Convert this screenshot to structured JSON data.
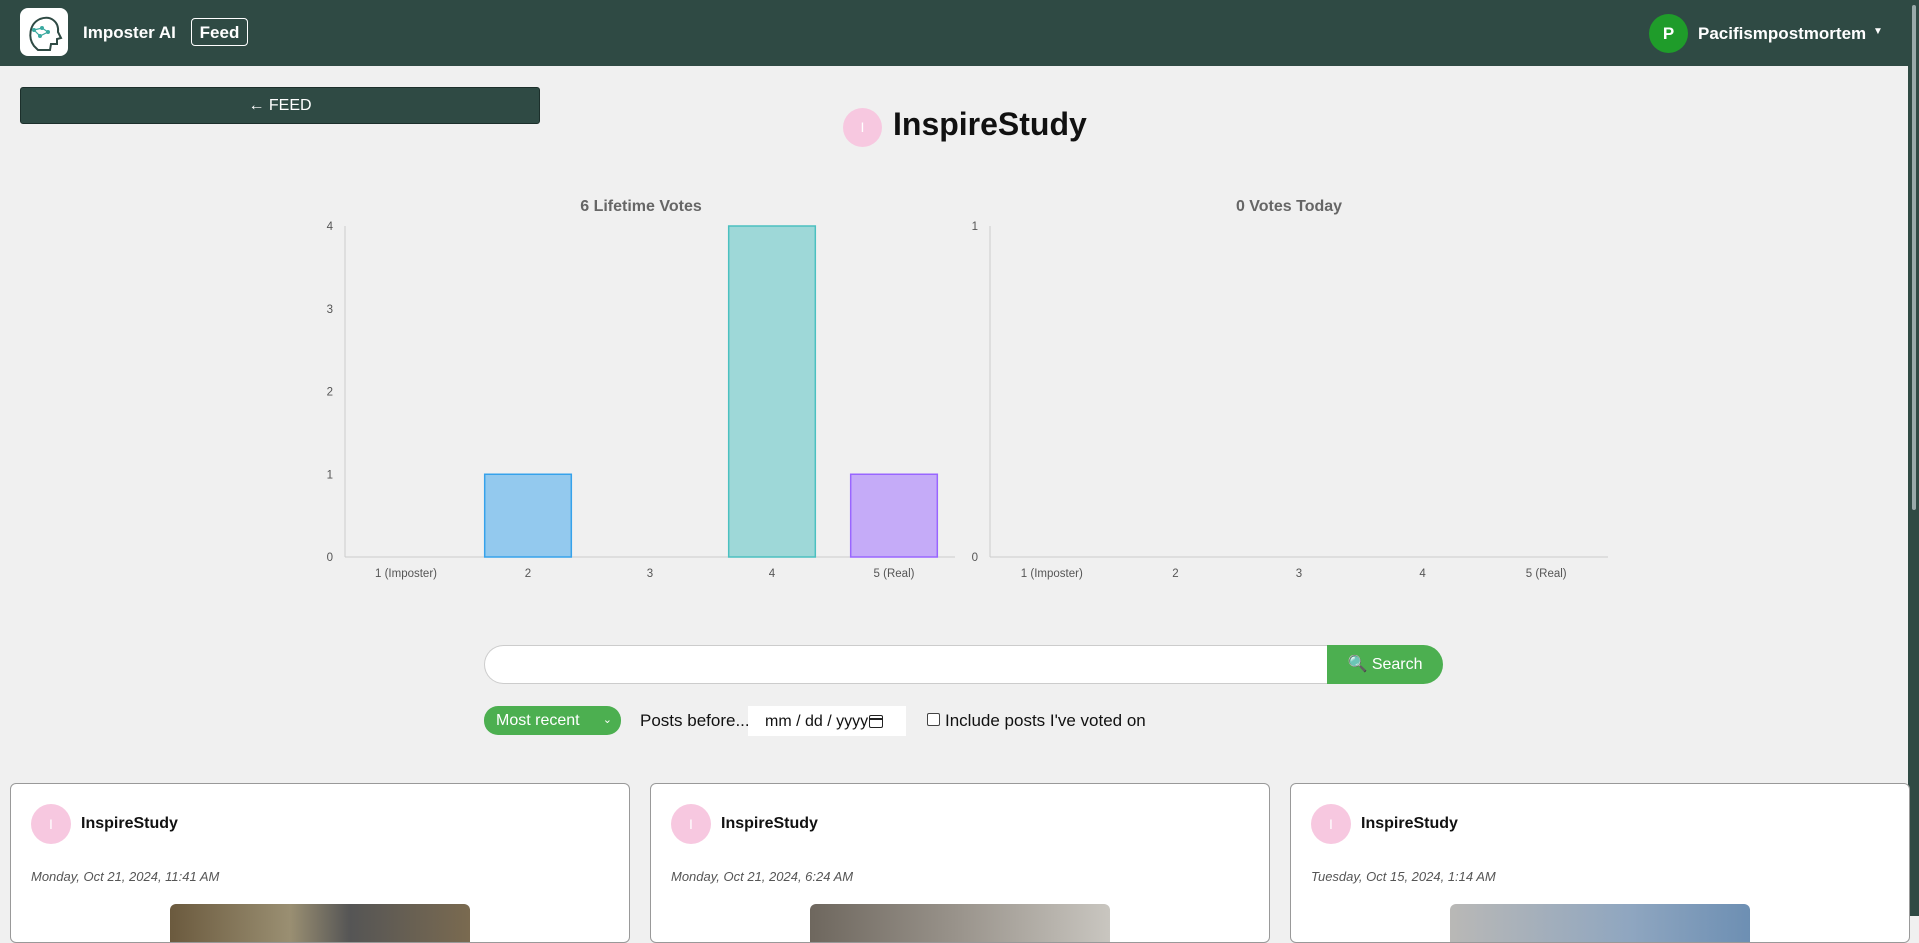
{
  "header": {
    "app_name": "Imposter AI",
    "feed_label": "Feed",
    "user_initial": "P",
    "username": "Pacifismpostmortem"
  },
  "back_label": "← FEED",
  "profile": {
    "initial": "I",
    "name": "InspireStudy"
  },
  "chart_data": [
    {
      "type": "bar",
      "title": "6 Lifetime Votes",
      "categories": [
        "1 (Imposter)",
        "2",
        "3",
        "4",
        "5 (Real)"
      ],
      "values": [
        0,
        1,
        0,
        4,
        1
      ],
      "colors": [
        "#36a2eb",
        "#36a2eb",
        "#ffce56",
        "#4bc0c0",
        "#9966ff"
      ],
      "yticks": [
        0,
        1,
        2,
        3,
        4
      ],
      "ylim": [
        0,
        4
      ],
      "grid": false,
      "legend": "none"
    },
    {
      "type": "bar",
      "title": "0 Votes Today",
      "categories": [
        "1 (Imposter)",
        "2",
        "3",
        "4",
        "5 (Real)"
      ],
      "values": [
        0,
        0,
        0,
        0,
        0
      ],
      "colors": [
        "#36a2eb",
        "#36a2eb",
        "#ffce56",
        "#4bc0c0",
        "#9966ff"
      ],
      "yticks": [
        0,
        1
      ],
      "ylim": [
        0,
        1
      ],
      "grid": false,
      "legend": "none"
    }
  ],
  "search": {
    "value": "",
    "button_label": "🔍 Search"
  },
  "filters": {
    "sort_selected": "Most recent",
    "posts_before_label": "Posts before...",
    "date_placeholder": "mm / dd / yyyy",
    "include_voted_label": "Include posts I've voted on",
    "include_voted_checked": false
  },
  "posts": [
    {
      "initial": "I",
      "user": "InspireStudy",
      "date": "Monday, Oct 21, 2024, 11:41 AM"
    },
    {
      "initial": "I",
      "user": "InspireStudy",
      "date": "Monday, Oct 21, 2024, 6:24 AM"
    },
    {
      "initial": "I",
      "user": "InspireStudy",
      "date": "Tuesday, Oct 15, 2024, 1:14 AM"
    }
  ],
  "colors": {
    "header_bg": "#2f4a44",
    "accent_green": "#4caf50",
    "avatar_pink": "#f7c8e0",
    "user_avatar_green": "#1f9c2a"
  }
}
